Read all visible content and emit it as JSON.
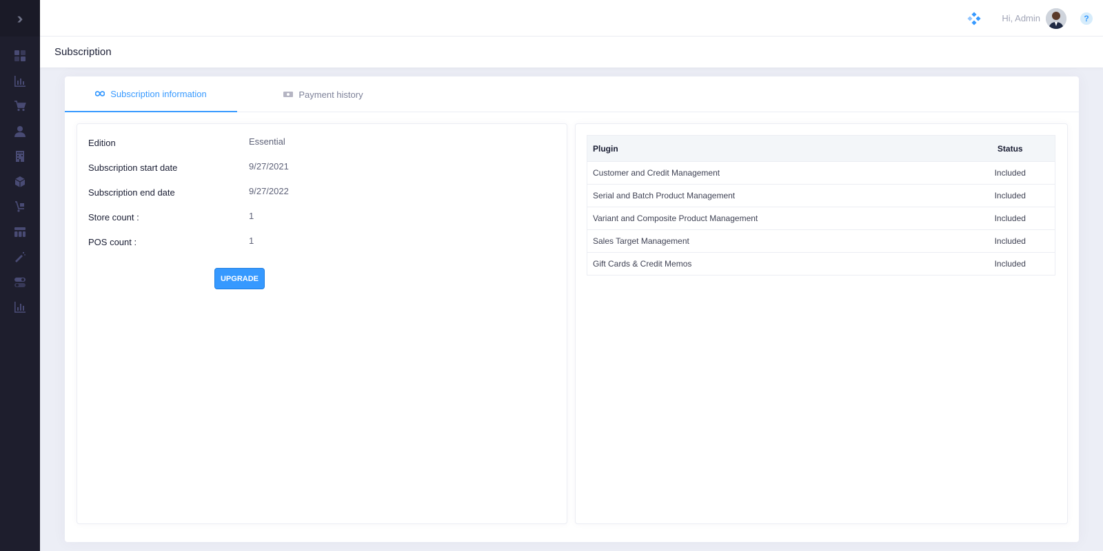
{
  "sidebar": {
    "toggle_icon": "double-chevron-right-icon",
    "items": [
      {
        "icon": "dashboard-icon"
      },
      {
        "icon": "bar-chart-icon"
      },
      {
        "icon": "cart-icon"
      },
      {
        "icon": "user-icon"
      },
      {
        "icon": "building-icon"
      },
      {
        "icon": "box-icon"
      },
      {
        "icon": "cart-flow-icon"
      },
      {
        "icon": "layout-icon"
      },
      {
        "icon": "magic-wand-icon"
      },
      {
        "icon": "toggle-icon"
      },
      {
        "icon": "analytics-icon"
      }
    ]
  },
  "header": {
    "greeting": "Hi, Admin",
    "quick_icon": "diamond-dots-icon",
    "help_label": "?"
  },
  "subheader": {
    "title": "Subscription"
  },
  "tabs": [
    {
      "label": "Subscription information",
      "icon": "infinity-icon",
      "active": true
    },
    {
      "label": "Payment history",
      "icon": "money-icon",
      "active": false
    }
  ],
  "subscription": {
    "rows": [
      {
        "label": "Edition",
        "value": "Essential"
      },
      {
        "label": "Subscription start date",
        "value": "9/27/2021"
      },
      {
        "label": "Subscription end date",
        "value": "9/27/2022"
      },
      {
        "label": "Store count :",
        "value": "1"
      },
      {
        "label": "POS count :",
        "value": "1"
      }
    ],
    "upgrade_label": "UPGRADE"
  },
  "plugins": {
    "headers": {
      "plugin": "Plugin",
      "status": "Status"
    },
    "rows": [
      {
        "name": "Customer and Credit Management",
        "status": "Included"
      },
      {
        "name": "Serial and Batch Product Management",
        "status": "Included"
      },
      {
        "name": "Variant and Composite Product Management",
        "status": "Included"
      },
      {
        "name": "Sales Target Management",
        "status": "Included"
      },
      {
        "name": "Gift Cards & Credit Memos",
        "status": "Included"
      }
    ]
  },
  "colors": {
    "accent": "#3699ff",
    "sidebar_bg": "#1e1e2d",
    "page_bg": "#eceef6"
  }
}
